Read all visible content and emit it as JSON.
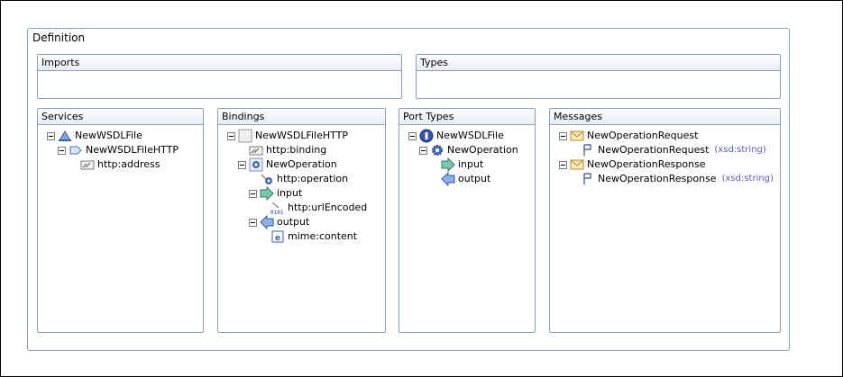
{
  "definition": {
    "title": "Definition"
  },
  "imports": {
    "title": "Imports"
  },
  "types": {
    "title": "Types"
  },
  "services": {
    "title": "Services",
    "service": "NewWSDLFile",
    "port": "NewWSDLFileHTTP",
    "address": "http:address"
  },
  "bindings": {
    "title": "Bindings",
    "binding": "NewWSDLFileHTTP",
    "http_binding": "http:binding",
    "operation": "NewOperation",
    "http_operation": "http:operation",
    "input": "input",
    "url_encoded": "http:urlEncoded",
    "output": "output",
    "mime_content": "mime:content"
  },
  "port_types": {
    "title": "Port Types",
    "port_type": "NewWSDLFile",
    "operation": "NewOperation",
    "input": "input",
    "output": "output"
  },
  "messages": {
    "title": "Messages",
    "request": "NewOperationRequest",
    "request_part": "NewOperationRequest",
    "request_part_type": "(xsd:string)",
    "response": "NewOperationResponse",
    "response_part": "NewOperationResponse",
    "response_part_type": "(xsd:string)"
  },
  "icons": {
    "service": "service-icon",
    "port": "port-icon",
    "address": "http-address-icon",
    "binding": "binding-icon",
    "operation": "operation-icon",
    "input": "input-arrow-icon",
    "output": "output-arrow-icon",
    "encoding": "binary-encoding-icon",
    "mime": "mime-content-icon",
    "port_type": "port-type-icon",
    "message": "envelope-icon",
    "part": "part-icon"
  }
}
